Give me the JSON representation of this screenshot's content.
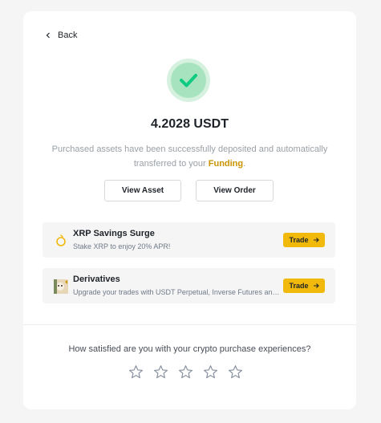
{
  "back": {
    "label": "Back"
  },
  "result": {
    "amount": "4.2028 USDT",
    "message_prefix": "Purchased assets have been successfully deposited and automatically transferred to your ",
    "message_link": "Funding",
    "message_suffix": "."
  },
  "actions": {
    "view_asset": "View Asset",
    "view_order": "View Order"
  },
  "promos": [
    {
      "title": "XRP Savings Surge",
      "desc": "Stake XRP to enjoy 20% APR!",
      "button": "Trade",
      "icon": "xrp-coin-icon"
    },
    {
      "title": "Derivatives",
      "desc": "Upgrade your trades with USDT Perpetual, Inverse Futures and more",
      "button": "Trade",
      "icon": "derivatives-image-icon"
    }
  ],
  "survey": {
    "question": "How satisfied are you with your crypto purchase experiences?",
    "rating": 0,
    "max_rating": 5
  },
  "colors": {
    "success_outer": "#d6f1e0",
    "success_inner": "#a7e3be",
    "check": "#0ecb81",
    "accent": "#f0b90b",
    "link": "#c99400"
  }
}
